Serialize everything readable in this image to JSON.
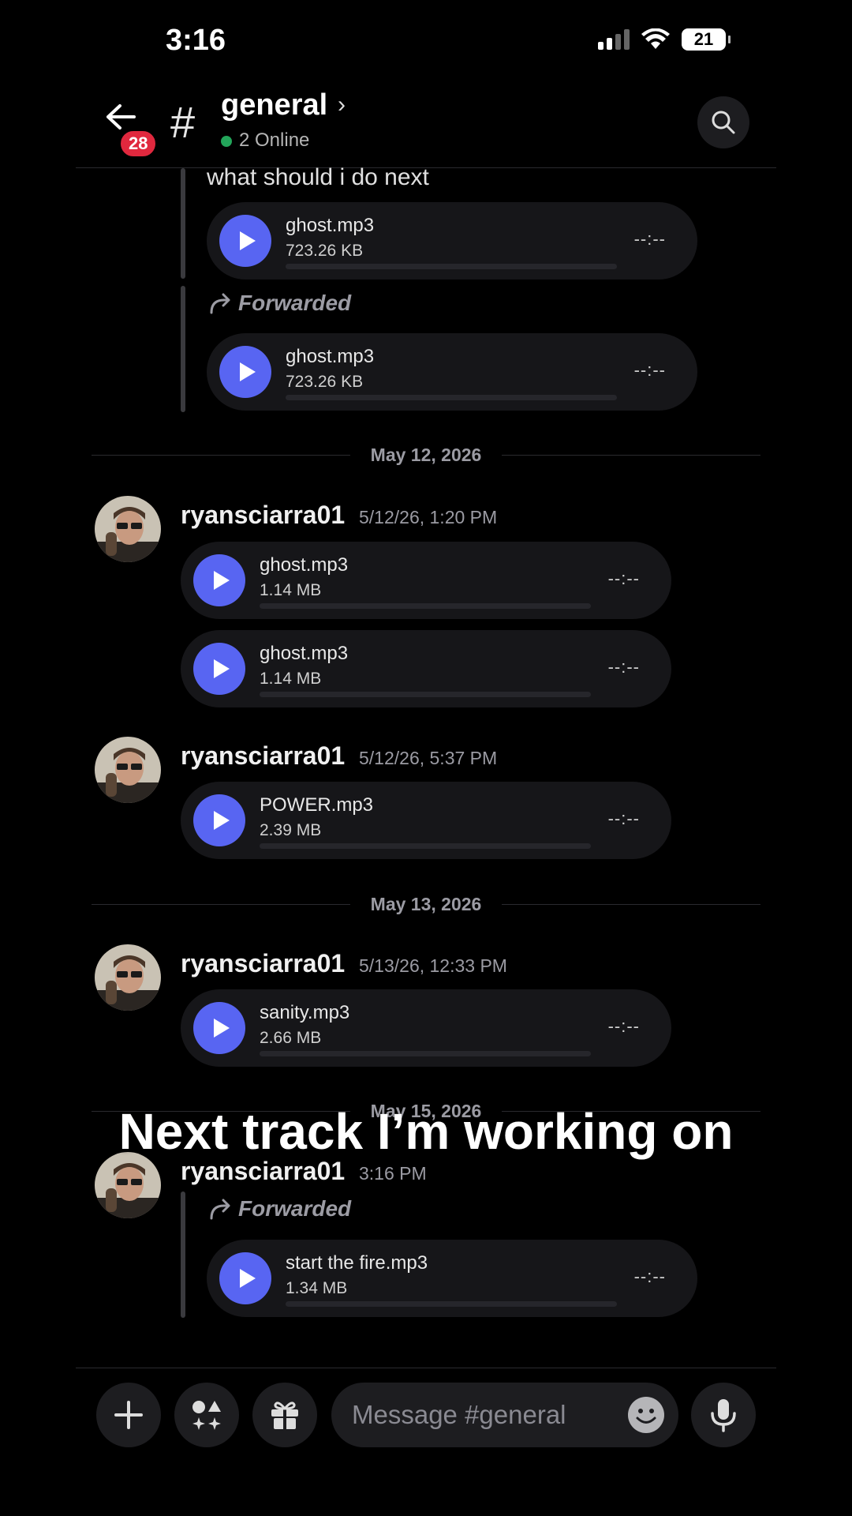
{
  "status_bar": {
    "time": "3:16",
    "battery": "21"
  },
  "header": {
    "back_badge": "28",
    "channel_name": "general",
    "online_text": "2 Online"
  },
  "messages": {
    "top_text": "what should i do next",
    "forwarded_label": "Forwarded",
    "audio": [
      {
        "name": "ghost.mp3",
        "size": "723.26 KB",
        "duration": "--:--"
      },
      {
        "name": "ghost.mp3",
        "size": "723.26 KB",
        "duration": "--:--"
      },
      {
        "name": "ghost.mp3",
        "size": "1.14 MB",
        "duration": "--:--"
      },
      {
        "name": "ghost.mp3",
        "size": "1.14 MB",
        "duration": "--:--"
      },
      {
        "name": "POWER.mp3",
        "size": "2.39 MB",
        "duration": "--:--"
      },
      {
        "name": "sanity.mp3",
        "size": "2.66 MB",
        "duration": "--:--"
      },
      {
        "name": "start the fire.mp3",
        "size": "1.34 MB",
        "duration": "--:--"
      }
    ],
    "dates": [
      "May 12, 2026",
      "May 13, 2026",
      "May 15, 2026"
    ],
    "authors": [
      {
        "username": "ryansciarra01",
        "timestamp": "5/12/26, 1:20 PM"
      },
      {
        "username": "ryansciarra01",
        "timestamp": "5/12/26, 5:37 PM"
      },
      {
        "username": "ryansciarra01",
        "timestamp": "5/13/26, 12:33 PM"
      },
      {
        "username": "ryansciarra01",
        "timestamp": "3:16 PM"
      }
    ]
  },
  "overlay_caption": "Next track I’m working on",
  "composer": {
    "placeholder": "Message #general"
  },
  "colors": {
    "accent": "#5865f2",
    "badge": "#e0283e",
    "online": "#23a55a",
    "background": "#000000"
  }
}
